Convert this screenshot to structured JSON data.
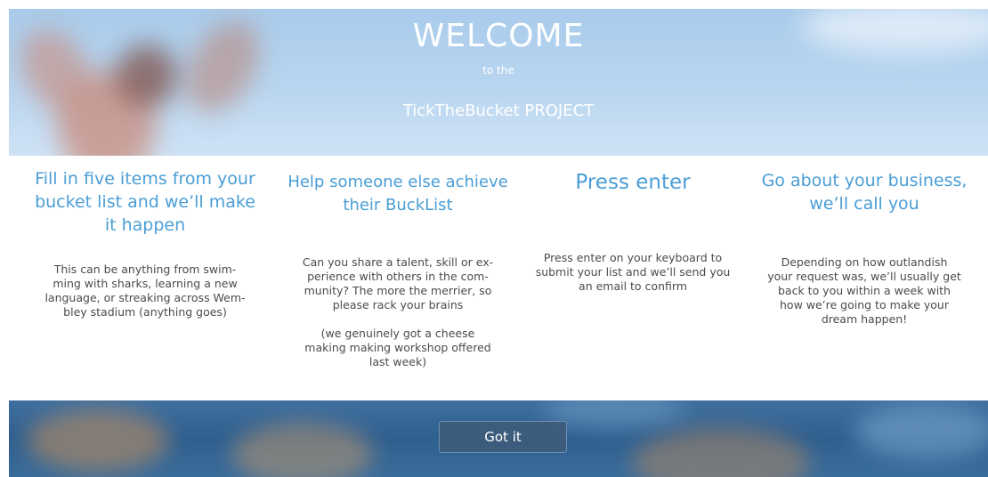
{
  "header": {
    "title": "WELCOME",
    "subtitle": "to the",
    "project": "TickTheBucket PROJECT"
  },
  "columns": [
    {
      "heading": "Fill in five items from your bucket list and we’ll make it happen",
      "body": [
        "This can be anything from swim-",
        "ming with sharks, learning a new",
        "language, or streaking across Wem-",
        "bley stadium (anything goes)"
      ]
    },
    {
      "heading": "Help someone else achieve their BuckList",
      "body": [
        "Can you share a talent, skill or ex-",
        "perience with others in the com-",
        "munity? The more the merrier, so",
        "please rack your brains"
      ],
      "note": [
        "(we genuinely got a cheese",
        "making  making workshop offered",
        "last week)"
      ]
    },
    {
      "heading": "Press enter",
      "body": [
        "Press enter on your keyboard to",
        "submit your list and we’ll send you",
        "an email to confirm"
      ]
    },
    {
      "heading": "Go about your business, we’ll call you",
      "body": [
        "Depending on how outlandish",
        "your request was, we’ll usually get",
        "back to you within a week with",
        "how we’re going to make your",
        "dream happen!"
      ]
    }
  ],
  "footer": {
    "button_label": "Got it"
  }
}
